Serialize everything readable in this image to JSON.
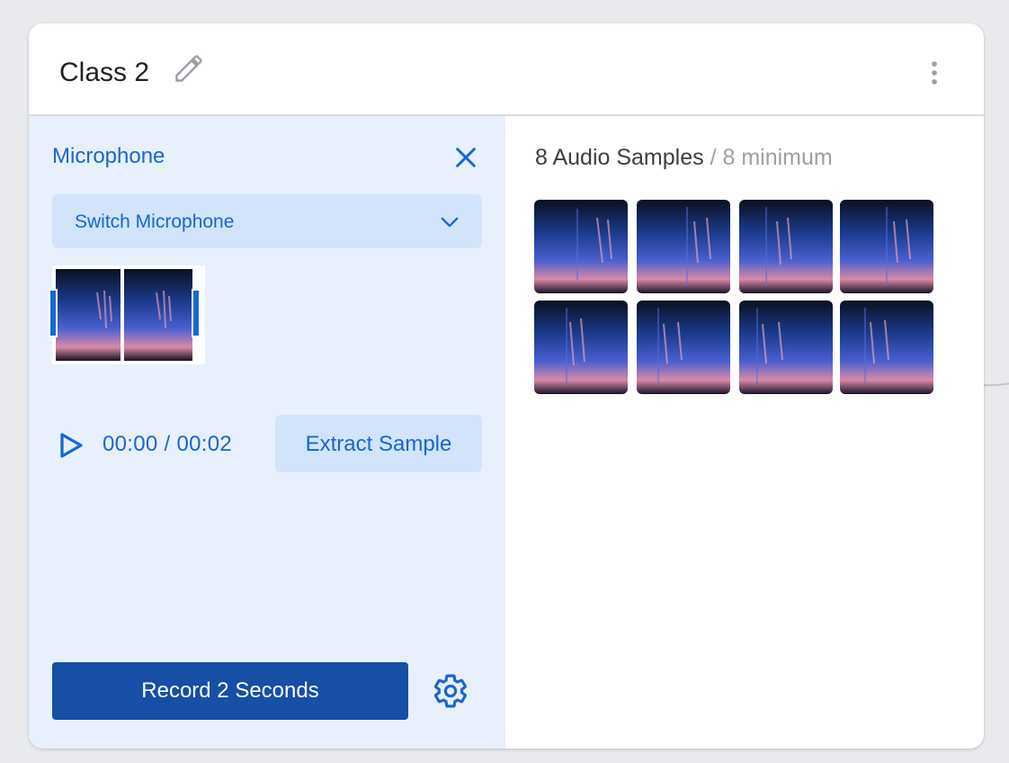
{
  "class_card": {
    "title": "Class 2",
    "icons": {
      "edit": "pencil-icon",
      "menu": "more-vert-icon"
    }
  },
  "microphone_panel": {
    "label": "Microphone",
    "close_icon": "close-icon",
    "switch_microphone": {
      "label": "Switch Microphone",
      "icon": "chevron-down-icon"
    },
    "playback": {
      "current_time": "00:00",
      "separator": "/",
      "total_time": "00:02",
      "play_icon": "play-icon"
    },
    "extract_sample_label": "Extract Sample",
    "record_button_label": "Record 2 Seconds",
    "settings_icon": "gear-icon"
  },
  "samples_panel": {
    "count_label": "8 Audio Samples",
    "separator": "/",
    "minimum_label": "8 minimum",
    "samples": [
      "sample-1",
      "sample-2",
      "sample-3",
      "sample-4",
      "sample-5",
      "sample-6",
      "sample-7",
      "sample-8"
    ]
  },
  "colors": {
    "accent": "#1967d2",
    "primary_button": "#174ea6",
    "panel_bg": "#e8f0fe",
    "chip_bg": "#d2e3fc",
    "page_bg": "#e8eaed"
  }
}
